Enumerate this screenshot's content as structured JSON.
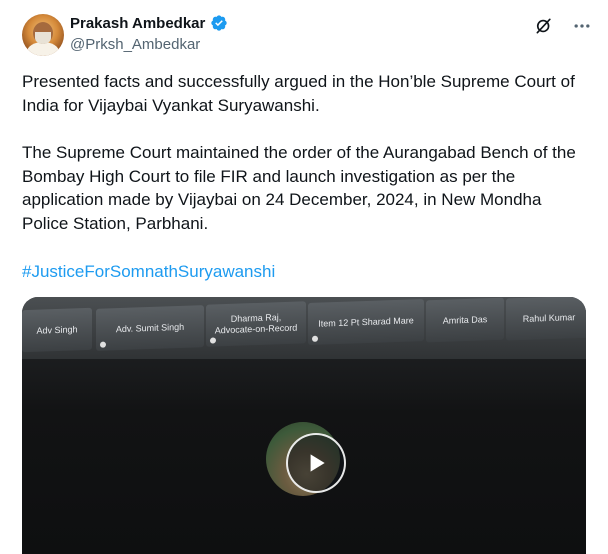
{
  "author": {
    "name": "Prakash Ambedkar",
    "handle": "@Prksh_Ambedkar"
  },
  "icons": {
    "avatar": "profile-photo",
    "verified": "verified-badge-icon",
    "grok": "grok-icon",
    "more": "more-options-icon",
    "play": "play-icon"
  },
  "colors": {
    "accent": "#1d9bf0",
    "text": "#0f1419",
    "secondary": "#536471"
  },
  "post": {
    "paragraph1": "Presented facts and successfully argued in the Hon’ble Supreme Court of India for Vijaybai Vyankat Suryawanshi.",
    "paragraph2": "The Supreme Court maintained the order of the Aurangabad Bench of the Bombay High Court to file FIR and launch investigation as per the application made by Vijaybai on 24 December, 2024, in New Mondha Police Station, Parbhani.",
    "hashtag": "#JusticeForSomnathSuryawanshi"
  },
  "video": {
    "participants": [
      "Adv Singh",
      "Adv. Sumit Singh",
      "Dharma Raj, Advocate-on-Record",
      "Item 12 Pt Sharad Mare",
      "Amrita Das",
      "Rahul Kumar"
    ]
  }
}
